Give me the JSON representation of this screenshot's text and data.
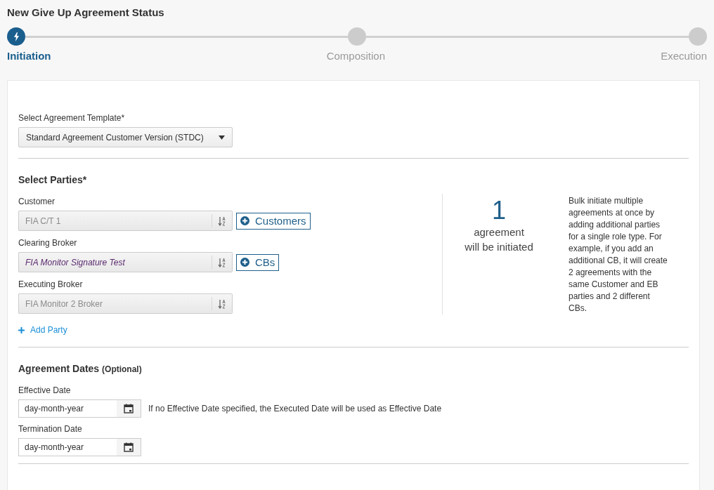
{
  "page_title": "New Give Up Agreement Status",
  "steps": [
    {
      "label": "Initiation",
      "selected": true
    },
    {
      "label": "Composition",
      "selected": false
    },
    {
      "label": "Execution",
      "selected": false
    }
  ],
  "template": {
    "label": "Select Agreement Template*",
    "value": "Standard Agreement Customer Version (STDC)"
  },
  "parties": {
    "heading": "Select Parties*",
    "fields": [
      {
        "label": "Customer",
        "placeholder": "FIA C/T 1",
        "add_button": "Customers"
      },
      {
        "label": "Clearing Broker",
        "value": "FIA Monitor Signature Test",
        "add_button": "CBs"
      },
      {
        "label": "Executing Broker",
        "placeholder": "FIA Monitor 2 Broker"
      }
    ],
    "add_party": "Add Party",
    "count": "1",
    "count_caption": "agreement",
    "count_caption_2": "will be initiated",
    "help": "Bulk initiate multiple agreements at once by adding additional parties for a single role type. For example, if you add an additional CB, it will create 2 agreements with the same Customer and EB parties and 2 different CBs."
  },
  "dates": {
    "heading": "Agreement Dates **(Optional)**",
    "fields": [
      {
        "label": "Effective Date",
        "placeholder": "day-month-year",
        "note": "If no Effective Date specified, the Executed Date will be used as Effective Date"
      },
      {
        "label": "Termination Date",
        "placeholder": "day-month-year"
      }
    ]
  }
}
